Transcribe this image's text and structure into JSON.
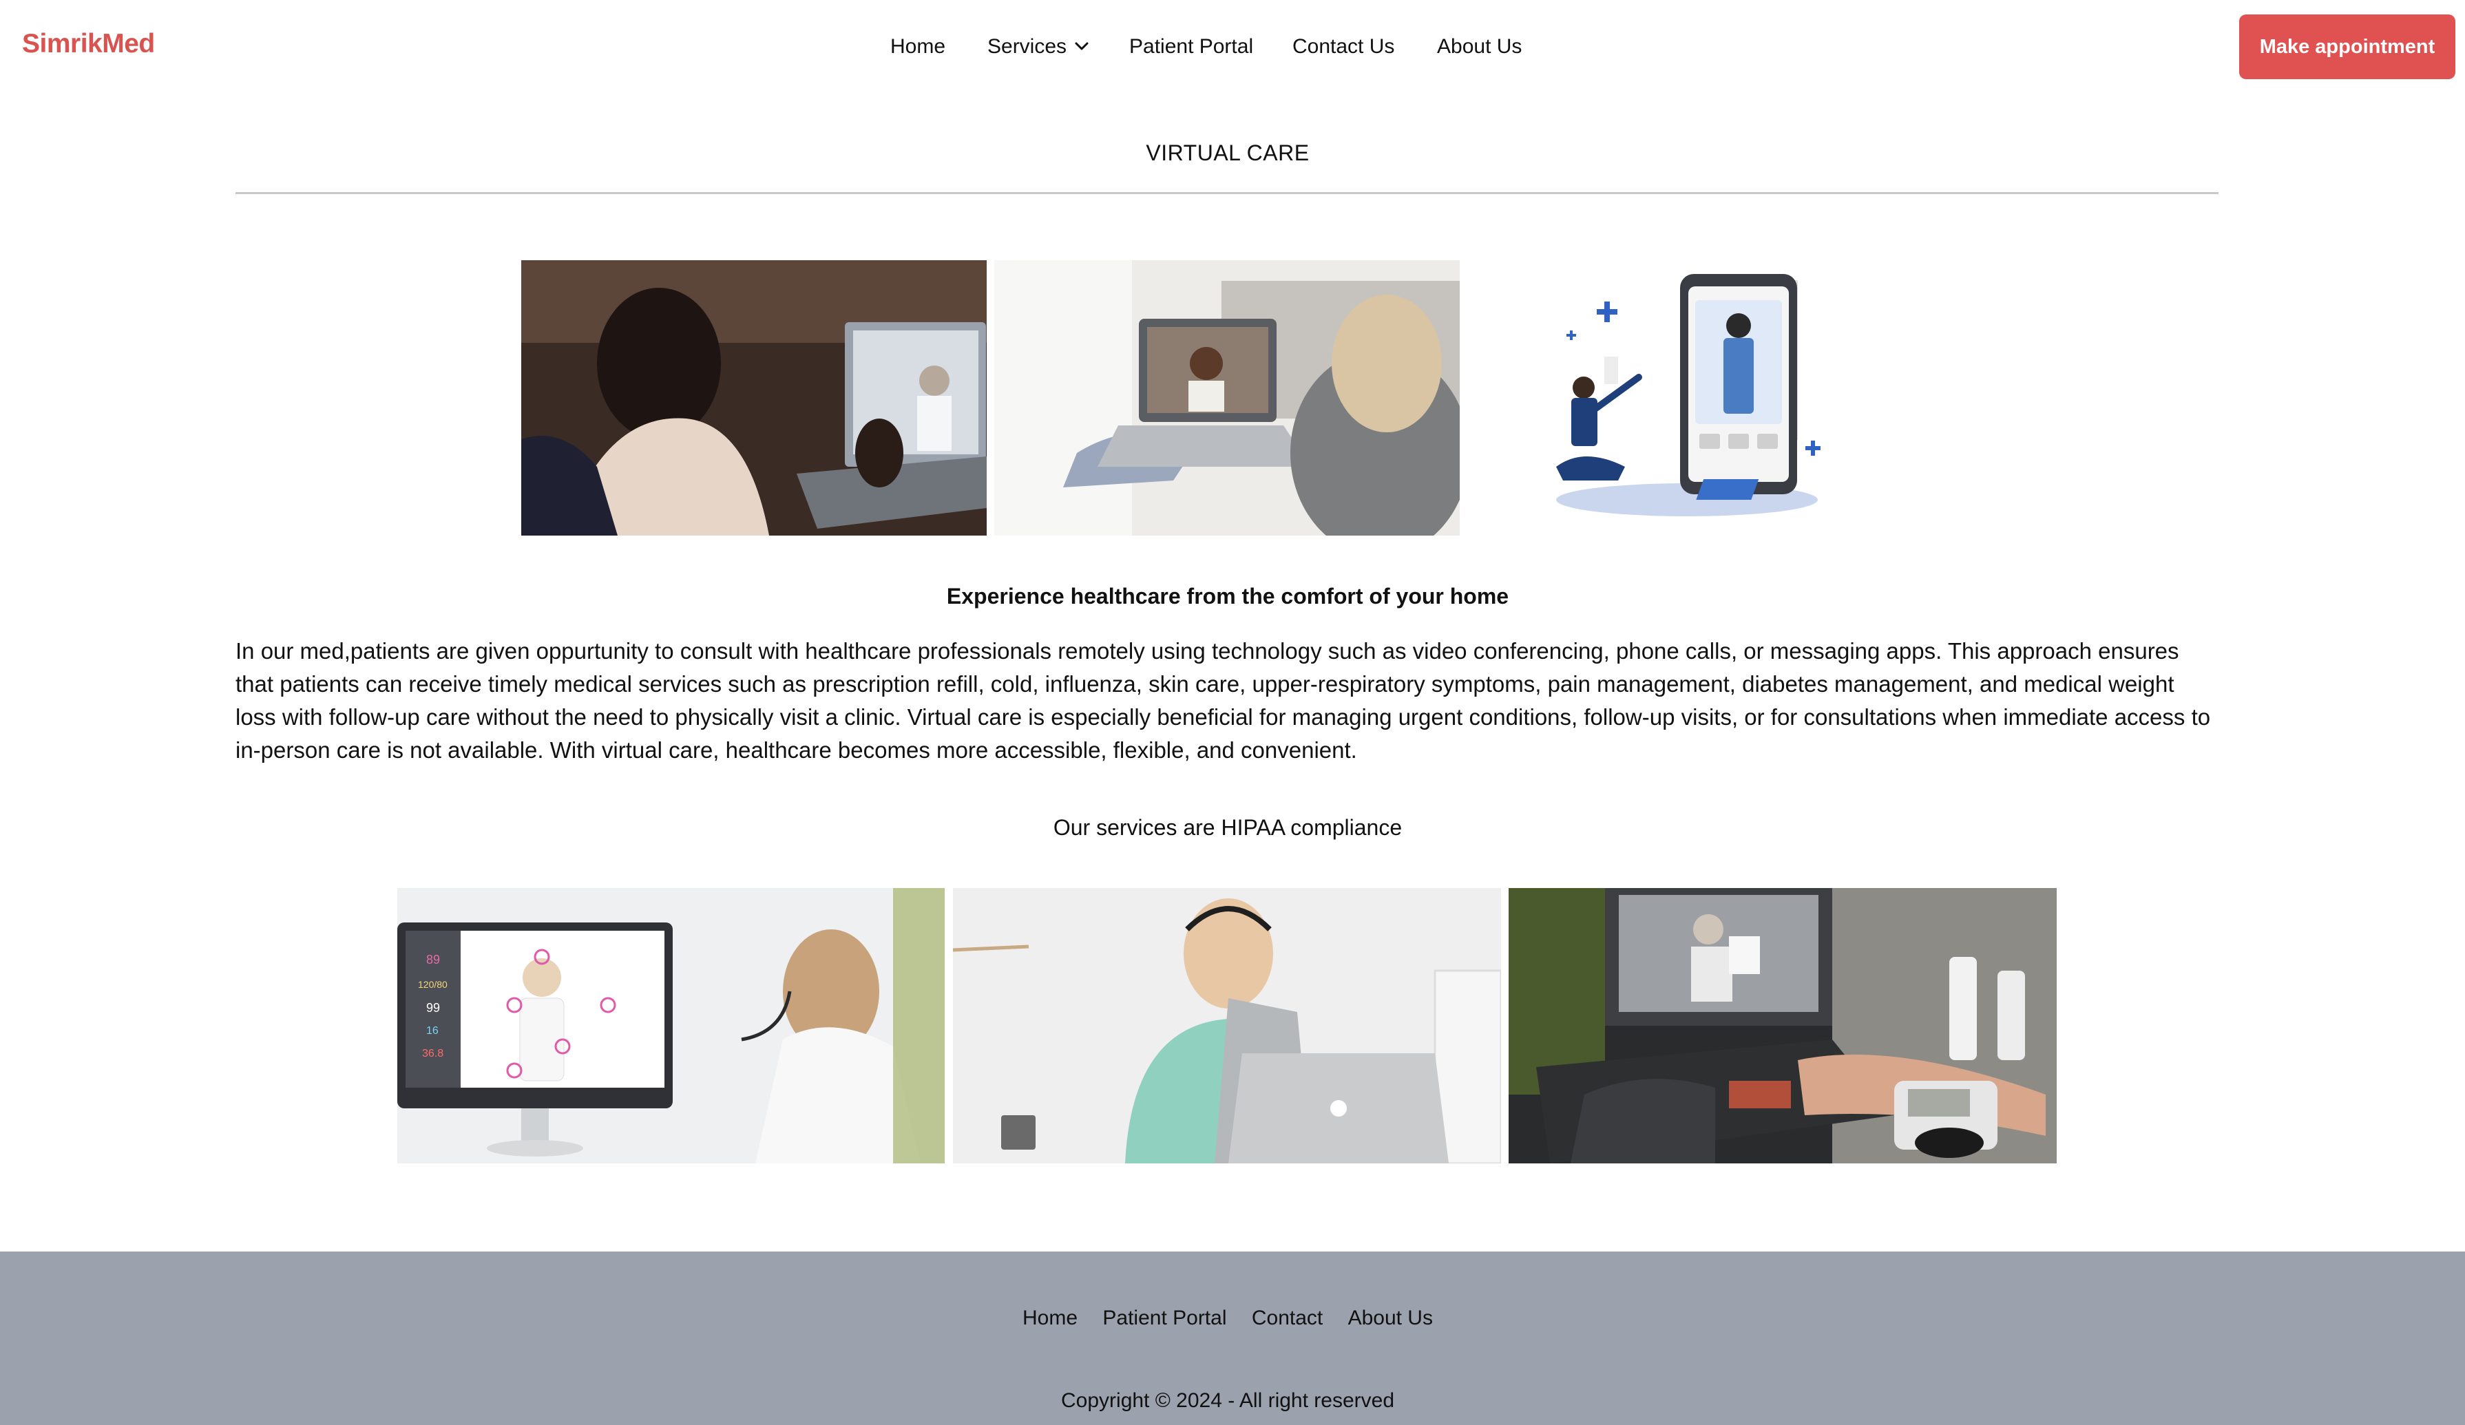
{
  "brand": {
    "logo": "SimrikMed",
    "accent": "#e05252",
    "logo_color": "#d9534f"
  },
  "nav": {
    "home": "Home",
    "services": "Services",
    "patient_portal": "Patient Portal",
    "contact": "Contact Us",
    "about": "About Us",
    "services_icon": "chevron-down-icon"
  },
  "cta": {
    "label": "Make appointment"
  },
  "page": {
    "section_title": "VIRTUAL CARE",
    "subheading": "Experience healthcare from the comfort of your home",
    "paragraph": "In our med,patients are given oppurtunity to consult with healthcare professionals remotely using technology such as video conferencing, phone calls, or messaging apps. This approach ensures that patients can receive timely medical services such as prescription refill, cold, influenza, skin care, upper-respiratory symptoms, pain management, diabetes management, and medical weight loss with follow-up care without the need to physically visit a clinic. Virtual care is especially beneficial for managing urgent conditions, follow-up visits, or for consultations when immediate access to in-person care is not available. With virtual care, healthcare becomes more accessible, flexible, and convenient.",
    "hipaa": "Our services are HIPAA compliance"
  },
  "monitor_readouts": [
    "89",
    "120/80",
    "99",
    "16",
    "36.8"
  ],
  "footer": {
    "bg": "#9ba1ad",
    "links": [
      "Home",
      "Patient Portal",
      "Contact",
      "About Us"
    ],
    "copyright": "Copyright © 2024 - All right reserved"
  }
}
